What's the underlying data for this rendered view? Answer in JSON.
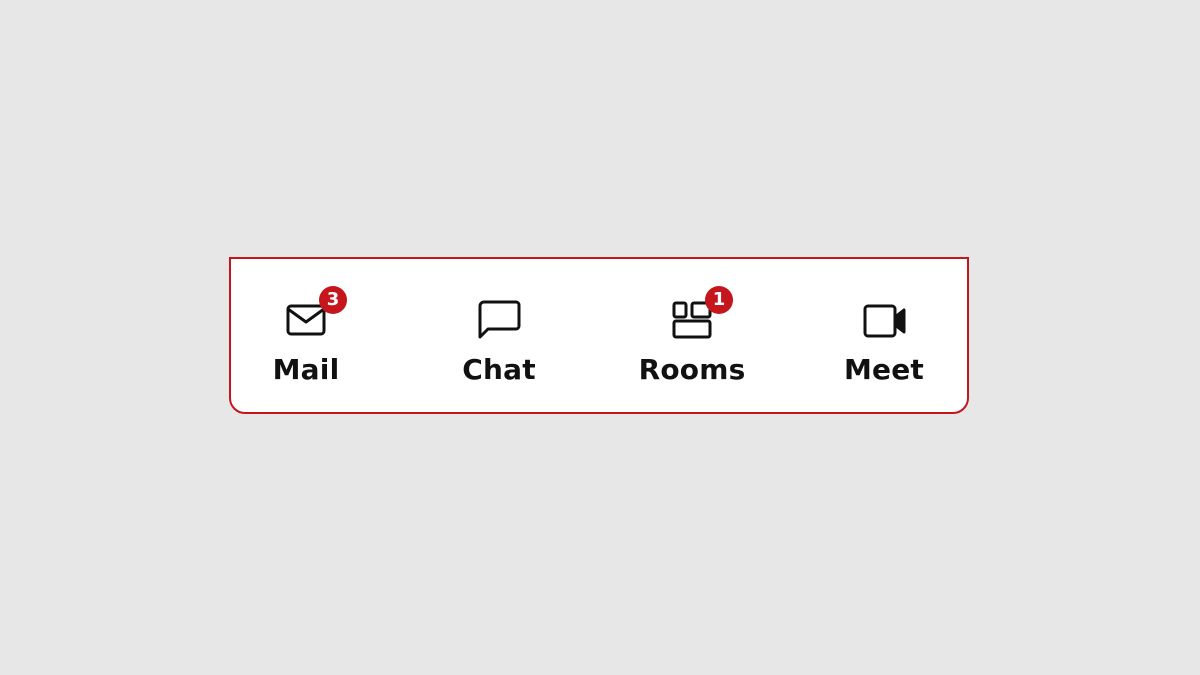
{
  "colors": {
    "background": "#e7e7e7",
    "bar": "#ffffff",
    "accent": "#c5161d",
    "text": "#111111",
    "badge_text": "#ffffff"
  },
  "nav": {
    "items": [
      {
        "label": "Mail",
        "icon": "mail-icon",
        "badge": "3"
      },
      {
        "label": "Chat",
        "icon": "chat-icon"
      },
      {
        "label": "Rooms",
        "icon": "rooms-icon",
        "badge": "1"
      },
      {
        "label": "Meet",
        "icon": "video-camera-icon"
      }
    ]
  }
}
